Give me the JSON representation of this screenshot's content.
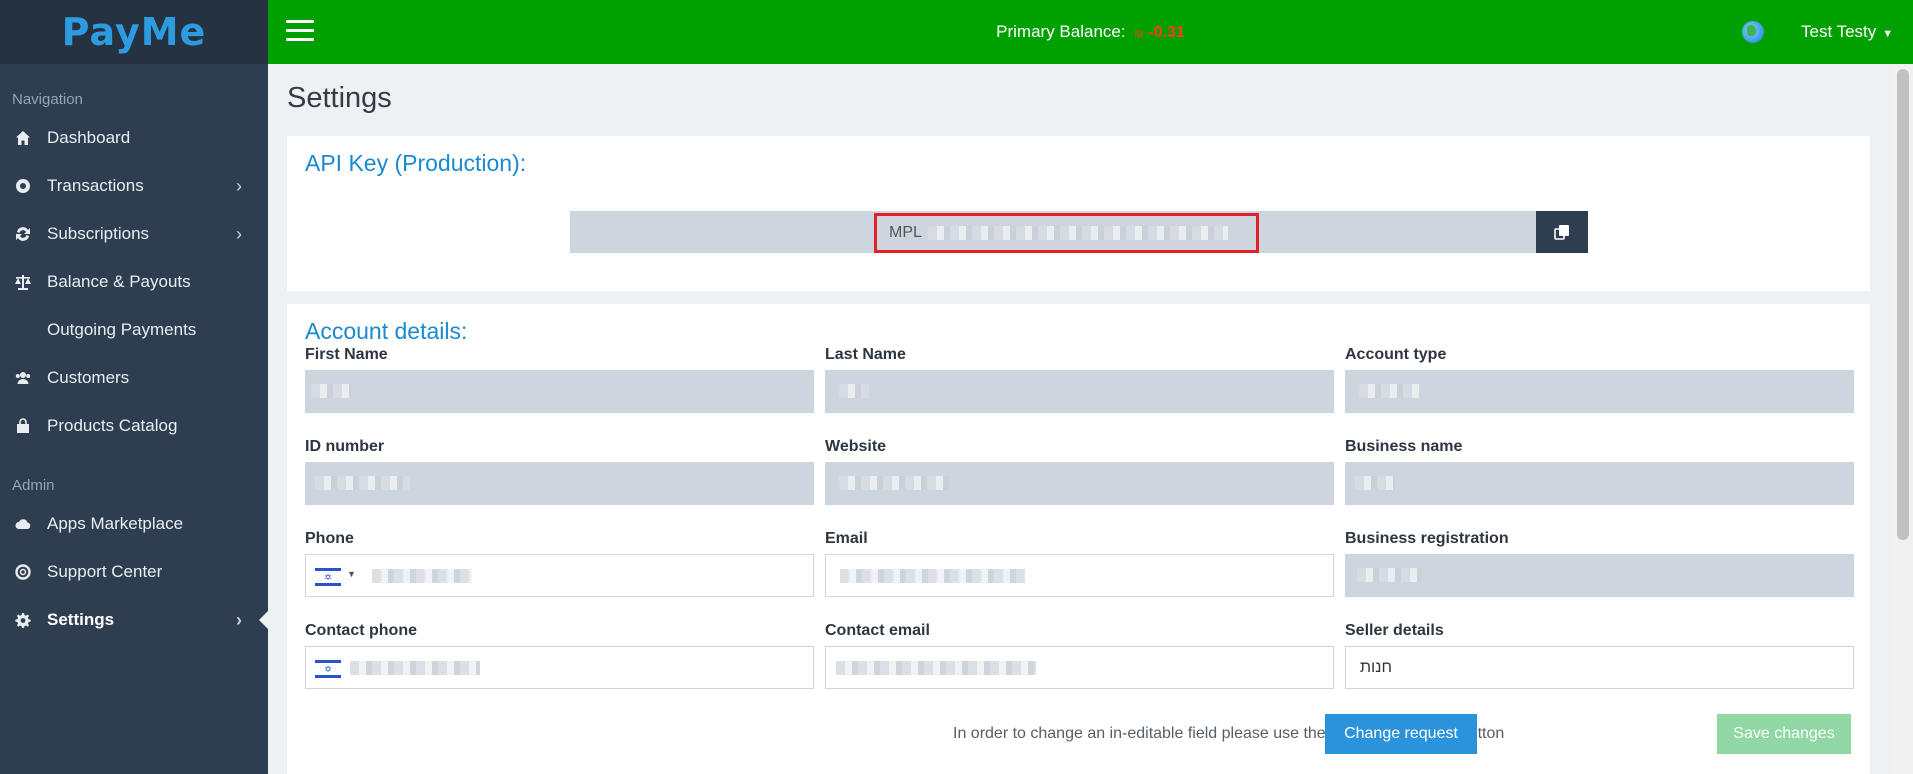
{
  "app": {
    "logo": "PayMe"
  },
  "topbar": {
    "balance_label": "Primary Balance:",
    "balance_currency": "₪",
    "balance_value": "-0.31",
    "user_name": "Test Testy"
  },
  "sidebar": {
    "section_navigation": "Navigation",
    "section_admin": "Admin",
    "items": [
      {
        "label": "Dashboard",
        "icon": "home-icon"
      },
      {
        "label": "Transactions",
        "icon": "transactions-icon"
      },
      {
        "label": "Subscriptions",
        "icon": "subscriptions-icon"
      },
      {
        "label": "Balance & Payouts",
        "icon": "scale-icon"
      },
      {
        "label": "Outgoing Payments"
      },
      {
        "label": "Customers",
        "icon": "users-icon"
      },
      {
        "label": "Products Catalog",
        "icon": "bag-icon"
      },
      {
        "label": "Apps Marketplace",
        "icon": "cloud-icon"
      },
      {
        "label": "Support Center",
        "icon": "lifebuoy-icon"
      },
      {
        "label": "Settings",
        "icon": "gear-icon"
      }
    ]
  },
  "page": {
    "title": "Settings"
  },
  "api_card": {
    "title": "API Key (Production):",
    "key_prefix": "MPL"
  },
  "account_card": {
    "title": "Account details:",
    "fields": {
      "first_name": "First Name",
      "last_name": "Last Name",
      "account_type": "Account type",
      "id_number": "ID number",
      "website": "Website",
      "business_name": "Business name",
      "phone": "Phone",
      "email": "Email",
      "business_registration": "Business registration",
      "contact_phone": "Contact phone",
      "contact_email": "Contact email",
      "seller_details": "Seller details"
    },
    "seller_details_value": "חנות",
    "note": "In order to change an in-editable field please use the \"Change request\" button",
    "change_request_label": "Change request",
    "save_label": "Save changes"
  }
}
